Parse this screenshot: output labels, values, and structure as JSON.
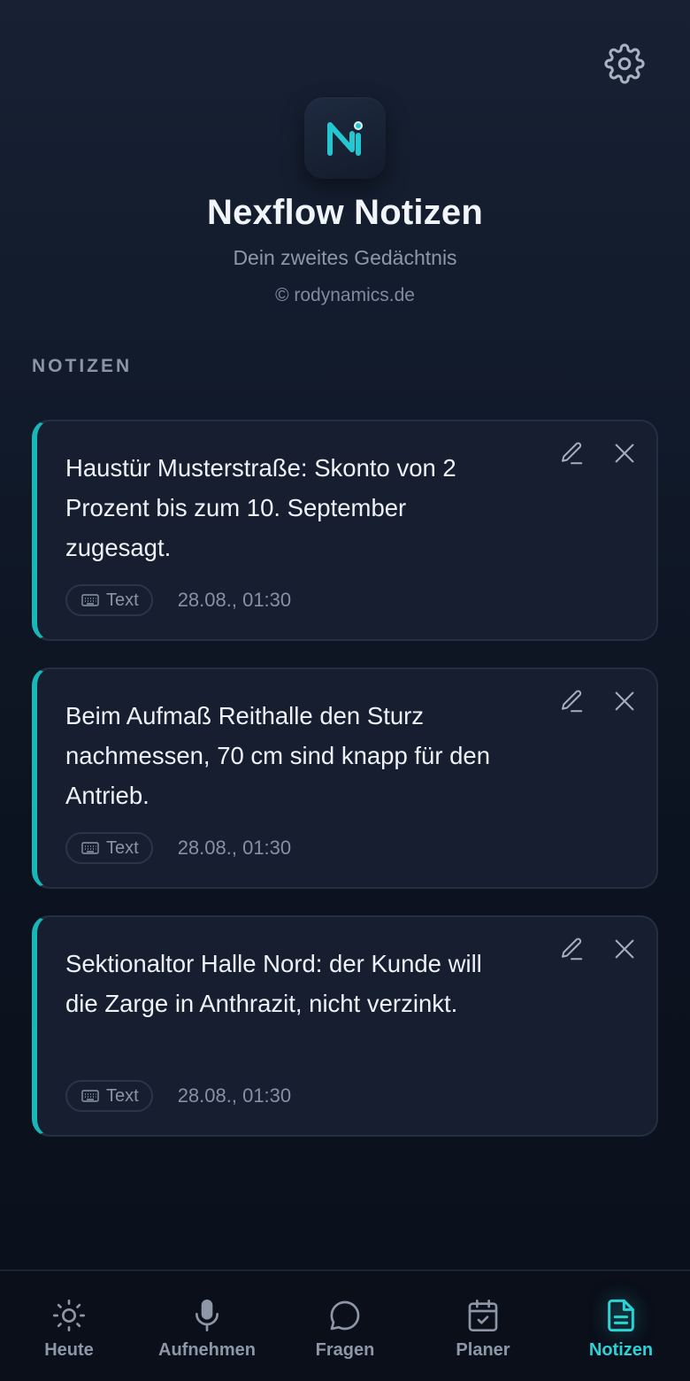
{
  "header": {
    "title": "Nexflow Notizen",
    "subtitle": "Dein zweites Gedächtnis",
    "credit": "© rodynamics.de",
    "settings_icon": "gear-icon",
    "logo_icon": "nexflow-logo"
  },
  "section": {
    "label": "NOTIZEN"
  },
  "notes": [
    {
      "text": "Haustür Musterstraße: Skonto von 2 Prozent bis zum 10. September zugesagt.",
      "tag": "Text",
      "time": "28.08., 01:30"
    },
    {
      "text": "Beim Aufmaß Reithalle den Sturz nachmessen, 70 cm sind knapp für den Antrieb.",
      "tag": "Text",
      "time": "28.08., 01:30"
    },
    {
      "text": "Sektionaltor Halle Nord: der Kunde will die Zarge in Anthrazit, nicht verzinkt.",
      "tag": "Text",
      "time": "28.08., 01:30"
    }
  ],
  "nav": {
    "items": [
      {
        "label": "Heute",
        "icon": "sun-icon",
        "active": false
      },
      {
        "label": "Aufnehmen",
        "icon": "microphone-icon",
        "active": false
      },
      {
        "label": "Fragen",
        "icon": "chat-bubble-icon",
        "active": false
      },
      {
        "label": "Planer",
        "icon": "calendar-check-icon",
        "active": false
      },
      {
        "label": "Notizen",
        "icon": "document-icon",
        "active": true
      }
    ]
  },
  "colors": {
    "accent": "#2ad3d6",
    "card_border_accent": "#18b6b6",
    "background": "#0c1320",
    "card_background": "#161e2f"
  }
}
